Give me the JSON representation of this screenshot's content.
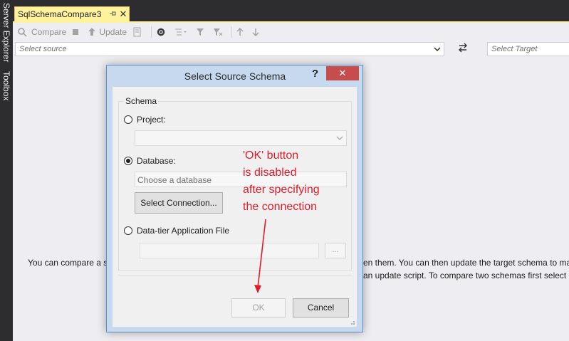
{
  "side_dock": {
    "server_explorer": "Server Explorer",
    "toolbox": "Toolbox"
  },
  "tab": {
    "title": "SqlSchemaCompare3",
    "pin_icon": "pin-icon",
    "close_glyph": "✕"
  },
  "toolbar": {
    "compare_label": "Compare",
    "update_label": "Update"
  },
  "source_row": {
    "source_placeholder": "Select source",
    "target_placeholder": "Select Target",
    "swap_icon": "swap-icon"
  },
  "content": {
    "info_line1_left": "You can compare a s",
    "info_line1_right": "en them.  You can then update the target schema to ma",
    "info_line2_right": "an update script.  To compare two schemas first select"
  },
  "dialog": {
    "title": "Select Source Schema",
    "help": "?",
    "close_glyph": "✕",
    "group_label": "Schema",
    "project_label": "Project:",
    "database_label": "Database:",
    "database_placeholder": "Choose a database",
    "select_connection_label": "Select Connection...",
    "dacpac_label": "Data-tier Application File",
    "browse_label": "...",
    "ok_label": "OK",
    "cancel_label": "Cancel",
    "selected_option": "Database"
  },
  "annotation": {
    "lines": [
      "'OK' button",
      "is disabled",
      "after specifying",
      "the connection"
    ],
    "color": "#e11c2a"
  },
  "colors": {
    "tab_accent": "#fff29d",
    "dark_chrome": "#2d2d30",
    "dialog_border": "#5b8fca",
    "close_red": "#c74c4c"
  }
}
